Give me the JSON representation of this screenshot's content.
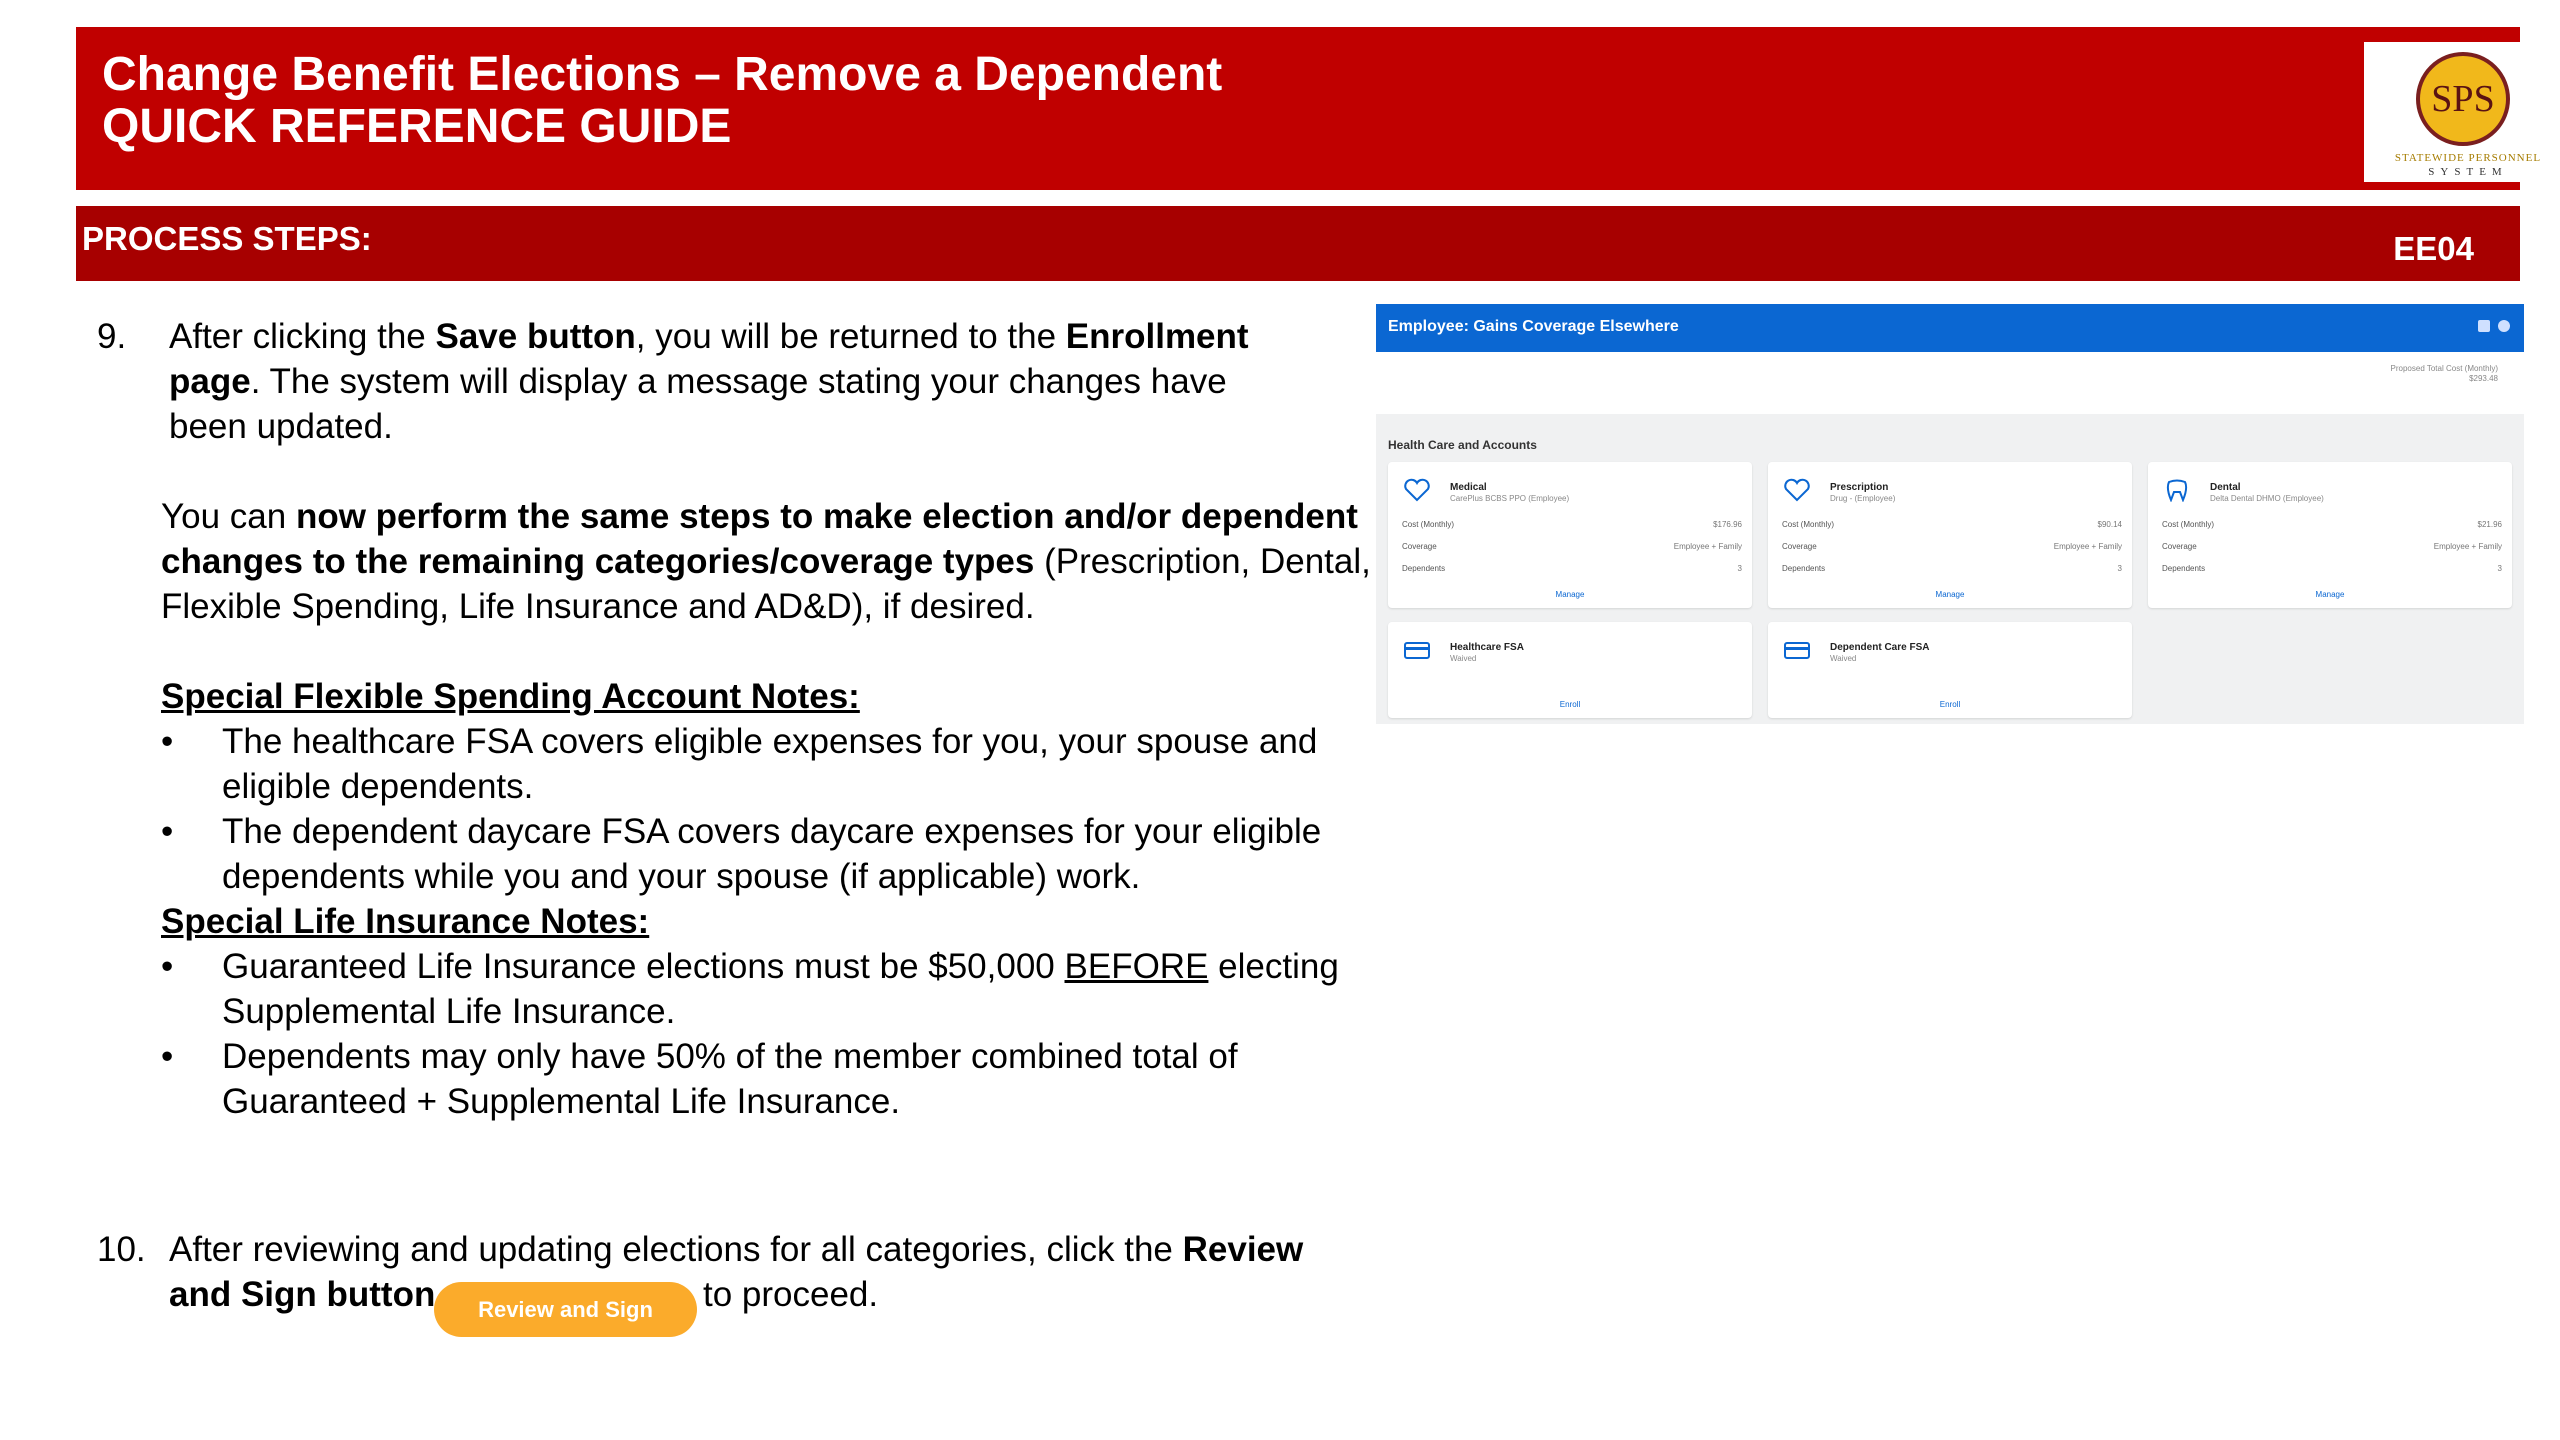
{
  "header": {
    "title_line1": "Change Benefit Elections – Remove a Dependent",
    "title_line2": "QUICK REFERENCE GUIDE",
    "logo": {
      "initials": "SPS",
      "line1": "STATEWIDE PERSONNEL",
      "line2": "SYSTEM"
    }
  },
  "process_bar": {
    "label": "PROCESS STEPS:",
    "code": "EE04"
  },
  "step9": {
    "number": "9.",
    "l1a": "After clicking the ",
    "l1b": "Save button",
    "l1c": ", you will be returned to the ",
    "l1d": "Enrollment",
    "l2a": "page",
    "l2b": ".  The system will display a message stating your changes have",
    "l3": "been updated."
  },
  "perform": {
    "l1a": "You can ",
    "l1b": "now perform the same steps to make election and/or dependent",
    "l2a": "changes to the remaining categories/coverage types",
    "l2b": " (Prescription, Dental,",
    "l3": "Flexible Spending, Life Insurance and AD&D), if desired."
  },
  "fsa_notes": {
    "heading": "Special Flexible Spending Account Notes:",
    "b1_l1": "The healthcare FSA covers eligible expenses for you, your spouse and",
    "b1_l2": "eligible dependents.",
    "b2_l1": "The dependent daycare FSA covers daycare expenses for your eligible",
    "b2_l2": "dependents while you and your spouse (if applicable) work."
  },
  "life_notes": {
    "heading": "Special Life Insurance Notes:",
    "b1_l1a": "Guaranteed Life Insurance elections must be $50,000 ",
    "b1_l1b": "BEFORE",
    "b1_l1c": " electing",
    "b1_l2": "Supplemental Life Insurance.",
    "b2_l1": "Dependents may only have 50% of the member combined total of",
    "b2_l2": "Guaranteed + Supplemental Life Insurance."
  },
  "step10": {
    "number": "10.",
    "l1a": "After reviewing and updating elections for all categories, click the ",
    "l1b": "Review",
    "l2a": "and Sign button",
    "button": "Review and Sign",
    "l2b": "to proceed."
  },
  "screenshot": {
    "bar_title": "Employee: Gains Coverage Elsewhere",
    "ptc_label": "Proposed Total Cost (Monthly)",
    "ptc_value": "$293.48",
    "section": "Health Care and Accounts",
    "cards": [
      {
        "name": "Medical",
        "sub": "CarePlus BCBS PPO (Employee)",
        "rows": [
          [
            "Cost (Monthly)",
            "$176.96"
          ],
          [
            "Coverage",
            "Employee + Family"
          ],
          [
            "Dependents",
            "3"
          ]
        ],
        "action": "Manage"
      },
      {
        "name": "Prescription",
        "sub": "Drug - (Employee)",
        "rows": [
          [
            "Cost (Monthly)",
            "$90.14"
          ],
          [
            "Coverage",
            "Employee + Family"
          ],
          [
            "Dependents",
            "3"
          ]
        ],
        "action": "Manage"
      },
      {
        "name": "Dental",
        "sub": "Delta Dental DHMO (Employee)",
        "rows": [
          [
            "Cost (Monthly)",
            "$21.96"
          ],
          [
            "Coverage",
            "Employee + Family"
          ],
          [
            "Dependents",
            "3"
          ]
        ],
        "action": "Manage"
      },
      {
        "name": "Healthcare FSA",
        "sub": "Waived",
        "rows": [],
        "action": "Enroll"
      },
      {
        "name": "Dependent Care FSA",
        "sub": "Waived",
        "rows": [],
        "action": "Enroll"
      }
    ]
  }
}
